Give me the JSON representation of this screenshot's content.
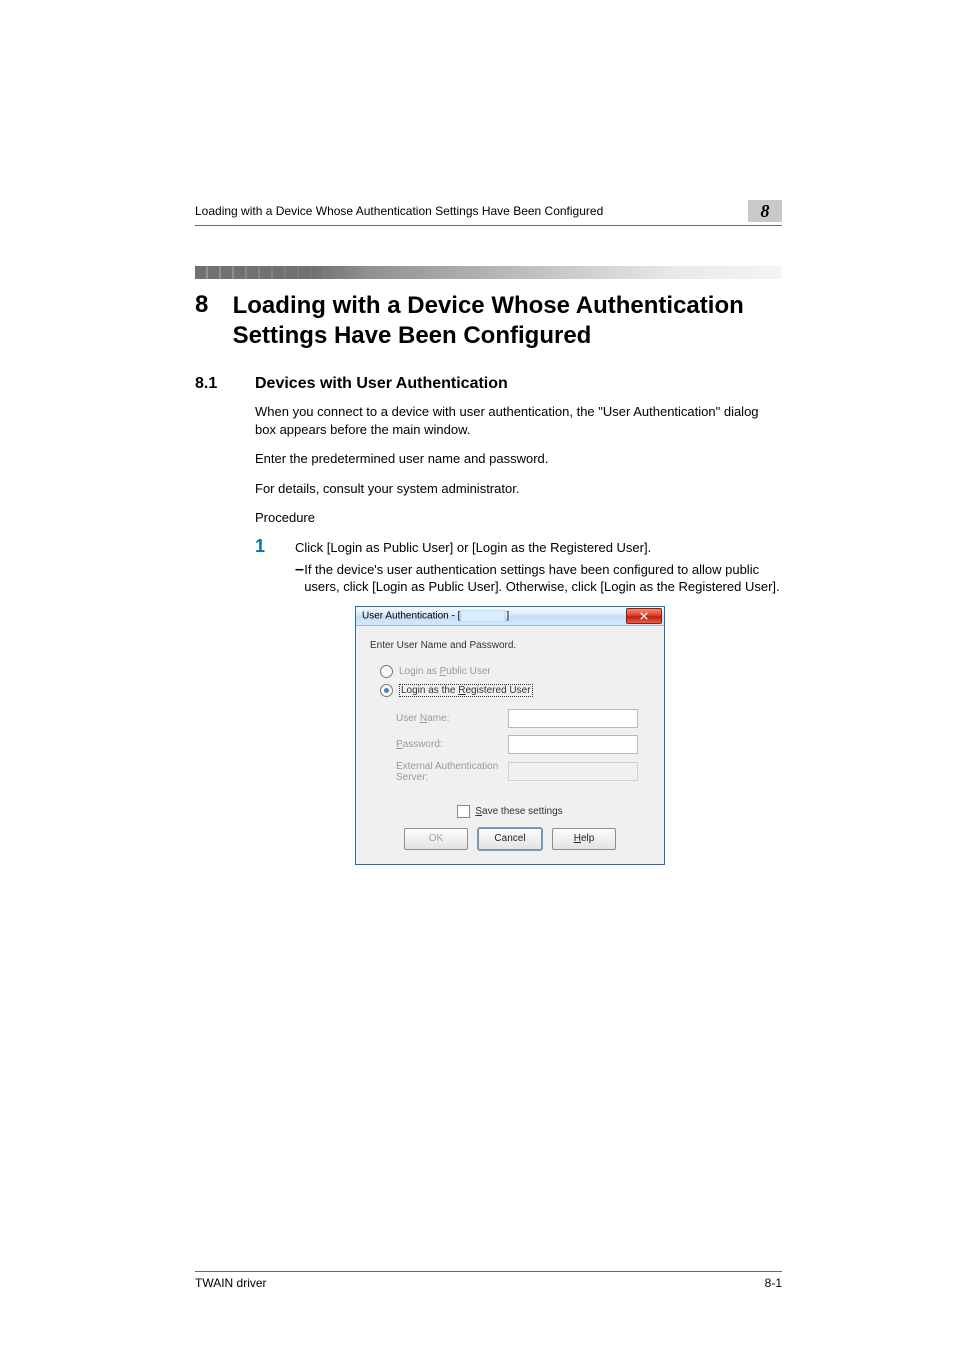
{
  "header": {
    "running_title": "Loading with a Device Whose Authentication Settings Have Been Configured",
    "chapter_badge": "8"
  },
  "title": {
    "chapter_number": "8",
    "chapter_title": "Loading with a Device Whose Authentication Settings Have Been Configured"
  },
  "section": {
    "number": "8.1",
    "heading": "Devices with User Authentication"
  },
  "body": {
    "p1": "When you connect to a device with user authentication, the \"User Authentication\" dialog box appears before the main window.",
    "p2": "Enter the predetermined user name and password.",
    "p3": "For details, consult your system administrator.",
    "p4": "Procedure"
  },
  "step": {
    "num": "1",
    "text": "Click [Login as Public User] or [Login as the Registered User].",
    "sub_bullet": "–",
    "sub_text": "If the device's user authentication settings have been configured to allow public users, click [Login as Public User]. Otherwise, click [Login as the Registered User]."
  },
  "dialog": {
    "title_prefix": "User Authentication - [",
    "title_suffix": "]",
    "prompt": "Enter User Name and Password.",
    "radio_public_pre": "Login as ",
    "radio_public_m": "P",
    "radio_public_post": "ublic User",
    "radio_reg_pre": "Login as the ",
    "radio_reg_m": "R",
    "radio_reg_post": "egistered User",
    "label_username_pre": "User ",
    "label_username_m": "N",
    "label_username_post": "ame:",
    "label_password_m": "P",
    "label_password_post": "assword:",
    "label_extauth": "External Authentication Server:",
    "save_m": "S",
    "save_post": "ave these settings",
    "btn_ok": "OK",
    "btn_cancel": "Cancel",
    "btn_help_m": "H",
    "btn_help_post": "elp"
  },
  "footer": {
    "left": "TWAIN driver",
    "right": "8-1"
  }
}
